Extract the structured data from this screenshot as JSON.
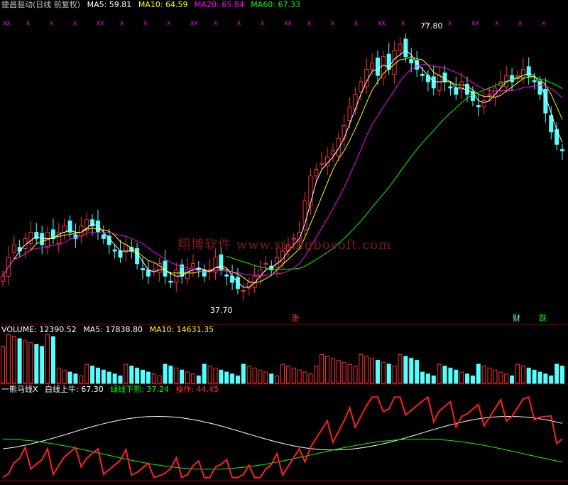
{
  "chart_data": [
    {
      "type": "candlestick",
      "title": "捷昌驱动(日线 前复权)",
      "indicators": [
        {
          "name": "MA5",
          "label": "MA5: 59.81",
          "color": "#ffffff"
        },
        {
          "name": "MA10",
          "label": "MA10: 64.59",
          "color": "#ffff00"
        },
        {
          "name": "MA20",
          "label": "MA20: 65.84",
          "color": "#ff00ff"
        },
        {
          "name": "MA60",
          "label": "MA60: 67.33",
          "color": "#00ff00"
        }
      ],
      "annotations": {
        "high": "77.80",
        "low": "37.70"
      },
      "watermark": "翔博软件 www.xiangbosoft.com",
      "markers": [
        "涨",
        "财",
        "跌"
      ],
      "ylim": [
        33,
        82
      ],
      "closes": [
        40,
        43,
        45,
        44,
        46,
        47,
        46,
        45,
        47,
        46,
        47,
        48,
        47,
        46,
        48,
        49,
        48,
        47,
        46,
        45,
        44,
        43,
        45,
        44,
        42,
        41,
        40,
        41,
        42,
        40,
        39,
        41,
        40,
        41,
        42,
        41,
        40,
        41,
        43,
        41,
        40,
        39,
        38,
        37.7,
        39,
        40,
        41,
        42,
        41,
        43,
        44,
        45,
        46,
        47,
        52,
        56,
        57,
        58,
        59,
        60,
        62,
        64,
        67,
        69,
        71,
        73,
        74,
        72,
        75,
        73,
        76,
        77,
        75,
        74,
        73,
        72,
        71,
        70,
        72,
        71,
        70,
        69,
        71,
        69,
        68,
        67,
        68,
        69,
        70,
        71,
        72,
        71,
        72,
        73,
        72,
        71,
        69,
        66,
        63,
        61,
        60
      ]
    },
    {
      "type": "bar",
      "title": "VOLUME",
      "indicators": [
        {
          "name": "VOLUME",
          "label": "VOLUME: 12390.52",
          "color": "#ffffff"
        },
        {
          "name": "MA5",
          "label": "MA5: 17838.80",
          "color": "#ffffff"
        },
        {
          "name": "MA10",
          "label": "MA10: 14631.35",
          "color": "#ffff00"
        }
      ]
    },
    {
      "type": "line",
      "title": "一熊马线X",
      "indicators": [
        {
          "name": "白线上牛",
          "label": "白线上牛: 67.30",
          "color": "#ffffff"
        },
        {
          "name": "绿线下熊",
          "label": "绿线下熊: 37.24",
          "color": "#00ff00"
        },
        {
          "name": "操作",
          "label": "操作: 44.45",
          "color": "#ff0000"
        }
      ]
    }
  ],
  "colors": {
    "up": "#ff3030",
    "down": "#54ffff",
    "ma5": "#ffffff",
    "ma10": "#ffff00",
    "ma20": "#ff00ff",
    "ma60": "#00ff00",
    "xmark": "#ff00ff"
  }
}
